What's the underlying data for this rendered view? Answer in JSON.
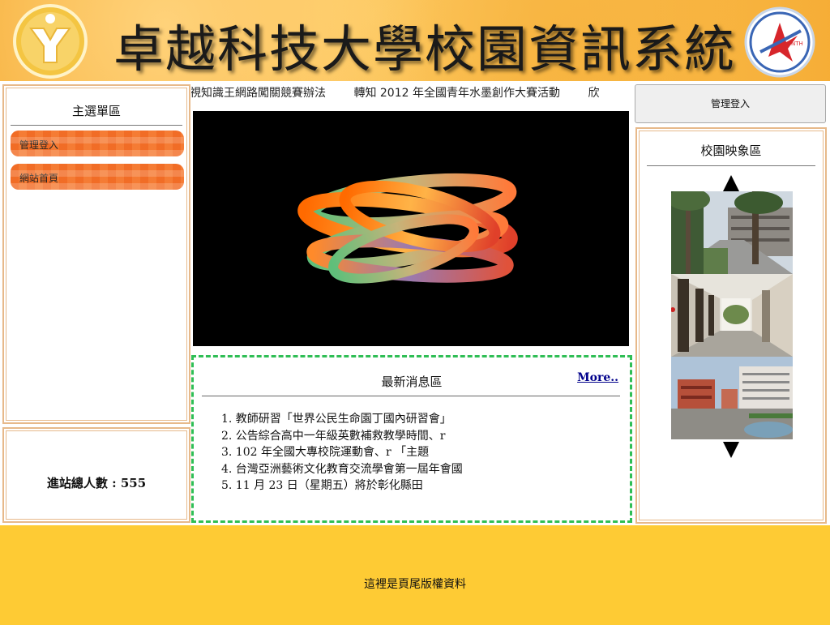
{
  "header": {
    "title": "卓越科技大學校園資訊系統",
    "logo_left_icon": "school-emblem-icon",
    "logo_right_icon": "star-emblem-icon",
    "logo_right_text": "NTH"
  },
  "left_menu": {
    "title": "主選單區",
    "items": [
      {
        "label": "管理登入"
      },
      {
        "label": "網站首頁"
      }
    ]
  },
  "visitor": {
    "label": "進站總人數 : 555"
  },
  "marquee": {
    "items": [
      "視知識王網路闖關競賽辦法",
      "轉知 2012 年全國青年水墨創作大賽活動",
      "欣"
    ]
  },
  "news": {
    "title": "最新消息區",
    "more": "More..",
    "items": [
      "1. 教師研習「世界公民生命園丁國內研習會」",
      "2. 公告綜合高中一年級英數補救教學時間、r",
      "3. 102 年全國大專校院運動會、r 「主題",
      "4. 台灣亞洲藝術文化教育交流學會第一屆年會國",
      "5. 11 月 23 日（星期五）將於彰化縣田"
    ]
  },
  "right": {
    "login_button": "管理登入",
    "campus_title": "校園映象區"
  },
  "footer": {
    "text": "這裡是頁尾版權資料"
  },
  "colors": {
    "header_orange": "#f6ad36",
    "menu_button": "#f9ac6b",
    "panel_border": "#e7b98a",
    "news_border": "#2fbe55",
    "footer": "#fecb34",
    "link": "#00008b"
  }
}
